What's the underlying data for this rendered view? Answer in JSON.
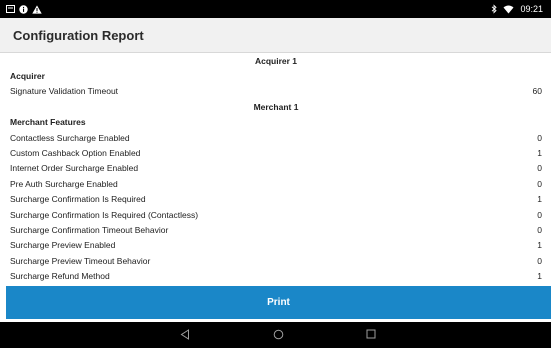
{
  "status_bar": {
    "time": "09:21",
    "icons": [
      "message-icon",
      "info-icon",
      "warning-icon",
      "bluetooth-icon",
      "wifi-icon"
    ]
  },
  "app_bar": {
    "title": "Configuration Report"
  },
  "report": {
    "acquirer_section": "Acquirer 1",
    "acquirer_heading": "Acquirer",
    "acquirer_rows": [
      {
        "label": "Signature Validation Timeout",
        "value": "60"
      }
    ],
    "merchant_section": "Merchant 1",
    "merchant_heading": "Merchant Features",
    "merchant_rows": [
      {
        "label": "Contactless Surcharge Enabled",
        "value": "0"
      },
      {
        "label": "Custom Cashback Option Enabled",
        "value": "1"
      },
      {
        "label": "Internet Order Surcharge Enabled",
        "value": "0"
      },
      {
        "label": "Pre Auth Surcharge Enabled",
        "value": "0"
      },
      {
        "label": "Surcharge Confirmation Is Required",
        "value": "1"
      },
      {
        "label": "Surcharge Confirmation Is Required (Contactless)",
        "value": "0"
      },
      {
        "label": "Surcharge Confirmation Timeout Behavior",
        "value": "0"
      },
      {
        "label": "Surcharge Preview Enabled",
        "value": "1"
      },
      {
        "label": "Surcharge Preview Timeout Behavior",
        "value": "0"
      },
      {
        "label": "Surcharge Refund Method",
        "value": "1"
      }
    ]
  },
  "print_button": {
    "label": "Print"
  },
  "nav_bar": {
    "icons": [
      "back-icon",
      "home-icon",
      "recents-icon"
    ]
  }
}
